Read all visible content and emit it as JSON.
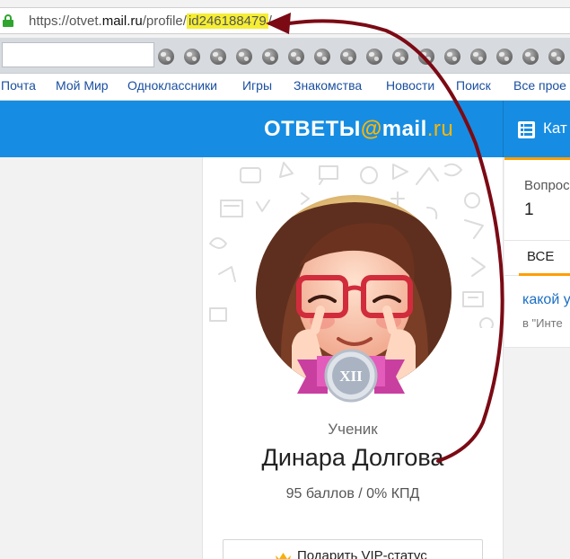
{
  "browser": {
    "url_prefix": "https://otvet.",
    "url_domain": "mail.ru",
    "url_path": "/profile/",
    "url_highlight": "id246188479",
    "url_suffix": "/",
    "highlight_color": "#f5ee34"
  },
  "portal_nav": {
    "items": [
      "Почта",
      "Мой Мир",
      "Одноклассники",
      "Игры",
      "Знакомства",
      "Новости",
      "Поиск",
      "Все прое"
    ]
  },
  "header": {
    "logo_word": "ОТВЕТЫ",
    "logo_at": "@",
    "logo_mail": "mail",
    "logo_ru": ".ru",
    "categories_label": "Кат",
    "bg_color": "#168de2",
    "accent_color": "#ffb600"
  },
  "profile": {
    "badge_level": "XII",
    "rank": "Ученик",
    "name": "Динара Долгова",
    "stats": "95 баллов / 0% КПД",
    "vip_button": "Подарить VIP-статус"
  },
  "right_panel": {
    "questions_label": "Вопросы",
    "questions_count": "1",
    "tab_all": "ВСЕ",
    "question_title": "какой у",
    "question_category": "в \"Инте",
    "accent_color": "#ff9e00"
  },
  "annotation": {
    "arrow_color": "#7b0a14"
  }
}
